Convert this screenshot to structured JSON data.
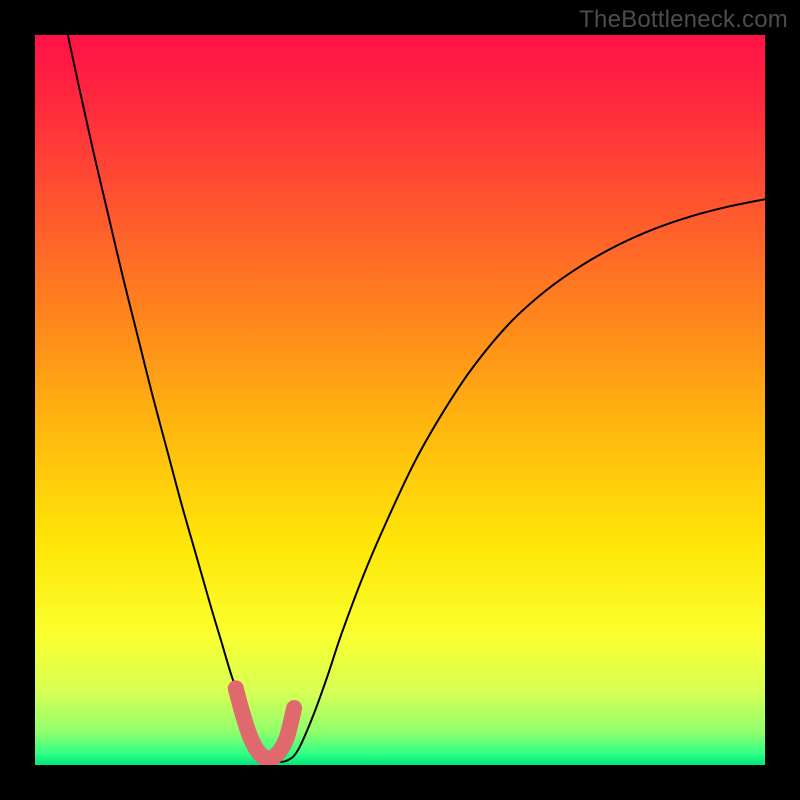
{
  "watermark": "TheBottleneck.com",
  "chart_data": {
    "type": "line",
    "title": "",
    "xlabel": "",
    "ylabel": "",
    "xlim": [
      0,
      100
    ],
    "ylim": [
      0,
      100
    ],
    "grid": false,
    "legend": false,
    "background_gradient_stops": [
      {
        "offset": 0.0,
        "color": "#ff1247"
      },
      {
        "offset": 0.1,
        "color": "#ff2b3e"
      },
      {
        "offset": 0.25,
        "color": "#ff5a2d"
      },
      {
        "offset": 0.4,
        "color": "#ff8a1c"
      },
      {
        "offset": 0.55,
        "color": "#ffbb0e"
      },
      {
        "offset": 0.7,
        "color": "#ffe708"
      },
      {
        "offset": 0.82,
        "color": "#fbff2e"
      },
      {
        "offset": 0.9,
        "color": "#d7ff55"
      },
      {
        "offset": 0.955,
        "color": "#8fff6c"
      },
      {
        "offset": 0.985,
        "color": "#2fff87"
      },
      {
        "offset": 1.0,
        "color": "#00e57a"
      }
    ],
    "series": [
      {
        "name": "bottleneck-curve",
        "stroke": "#000000",
        "stroke_width": 2.0,
        "x": [
          4.5,
          6,
          8,
          10,
          12,
          14,
          16,
          18,
          20,
          22,
          24,
          25.5,
          27,
          28.5,
          30,
          31.5,
          33,
          34.5,
          36,
          38,
          40,
          42,
          45,
          48,
          52,
          56,
          60,
          65,
          70,
          75,
          80,
          85,
          90,
          95,
          100
        ],
        "y": [
          100,
          93,
          84,
          75.5,
          67,
          59,
          51,
          43.5,
          36,
          29,
          22,
          17,
          12,
          8,
          4.6,
          2.0,
          0.6,
          0.6,
          2.0,
          6.5,
          12,
          18,
          26,
          33,
          41.5,
          48.5,
          54.5,
          60.5,
          65,
          68.5,
          71.3,
          73.5,
          75.2,
          76.5,
          77.5
        ]
      },
      {
        "name": "bottleneck-region",
        "stroke": "#e0696d",
        "stroke_width": 16,
        "linecap": "round",
        "x": [
          27.5,
          28.5,
          29.5,
          30.5,
          31.5,
          32.5,
          33.5,
          34.5,
          35.5
        ],
        "y": [
          10.5,
          6.8,
          3.8,
          1.9,
          1.0,
          1.0,
          1.9,
          3.8,
          7.8
        ]
      }
    ]
  }
}
